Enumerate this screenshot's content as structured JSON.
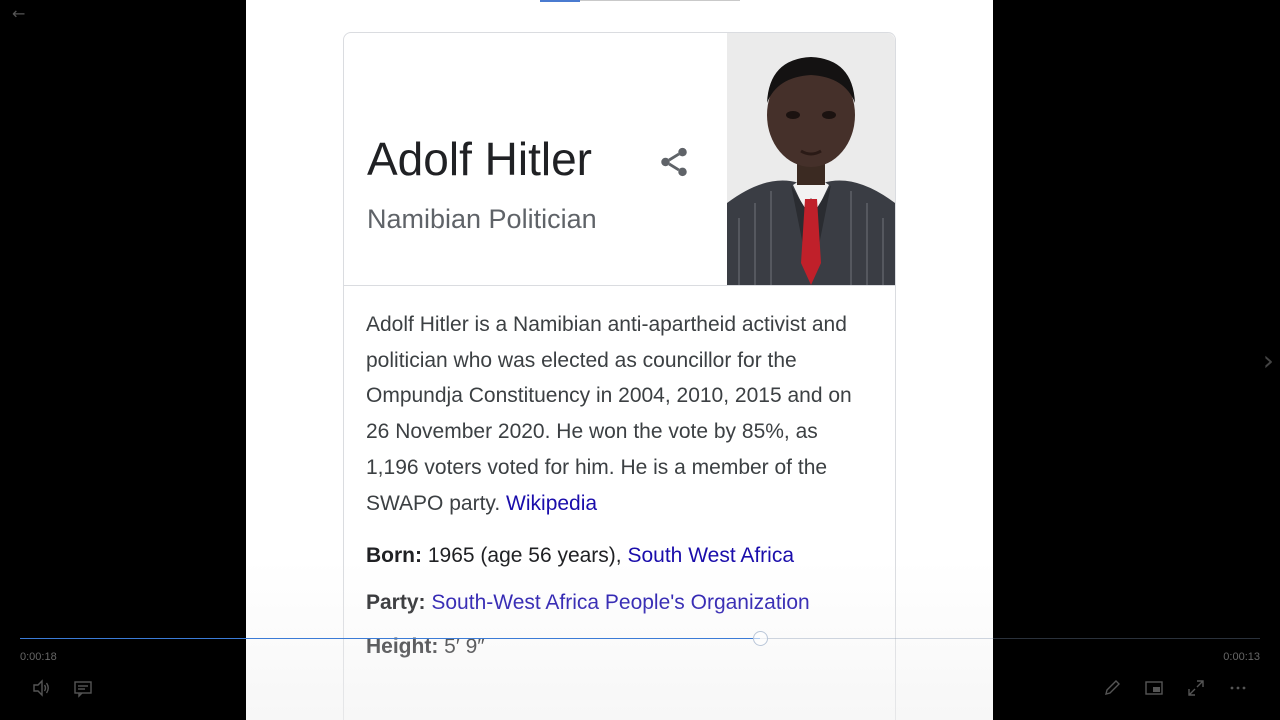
{
  "viewer": {
    "elapsed": "0:00:18",
    "remaining": "0:00:13",
    "progress_fraction": 0.597
  },
  "card": {
    "title": "Adolf Hitler",
    "subtitle": "Namibian Politician",
    "description": "Adolf Hitler is a Namibian anti-apartheid activist and politician who was elected as councillor for the Ompundja Constituency in 2004, 2010, 2015 and on 26 November 2020. He won the vote by 85%, as 1,196 voters voted for him. He is a member of the SWAPO party.",
    "source_link": "Wikipedia",
    "facts": {
      "born_label": "Born:",
      "born_value": "1965 (age 56 years),",
      "born_link": "South West Africa",
      "party_label": "Party:",
      "party_link": "South-West Africa People's Organization",
      "height_label": "Height:",
      "height_value": "5′ 9″"
    }
  },
  "icons": [
    "back-arrow-icon",
    "next-arrow-icon",
    "share-icon",
    "volume-icon",
    "captions-icon",
    "pen-icon",
    "picture-in-picture-icon",
    "fullscreen-icon",
    "more-icon"
  ],
  "colors": {
    "link": "#1a0dab",
    "title": "#202124",
    "subtitle": "#5f6368",
    "progress": "#3b7bd6"
  }
}
